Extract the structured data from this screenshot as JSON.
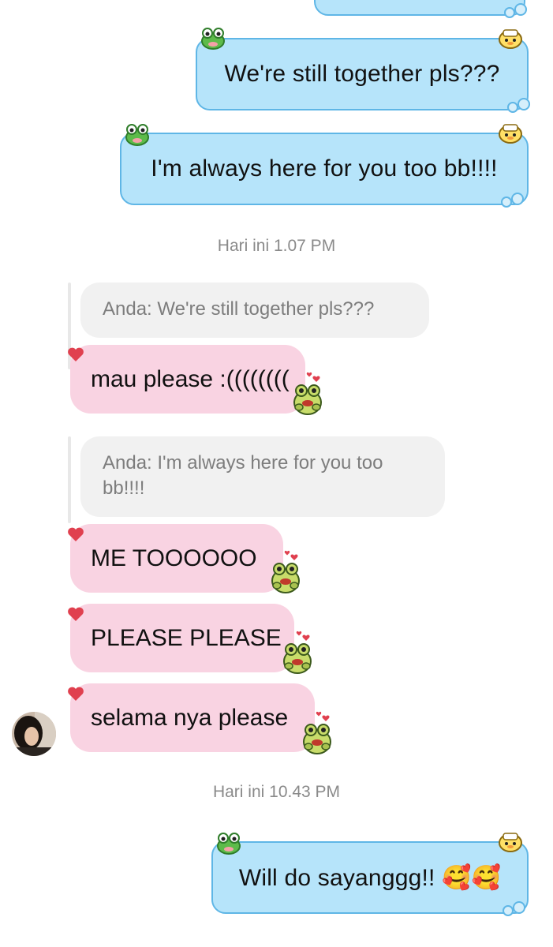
{
  "messages_top": [
    {
      "text": "We're still together pls???"
    },
    {
      "text": "I'm always here for you too bb!!!!"
    }
  ],
  "timestamp_1": "Hari ini 1.07 PM",
  "reply_1": {
    "quote": "Anda: We're still together pls???",
    "message": "mau please :(((((((("
  },
  "reply_2": {
    "quote": "Anda: I'm always here for you too bb!!!!",
    "messages": [
      "ME TOOOOOO",
      "PLEASE PLEASE",
      "selama nya please"
    ]
  },
  "timestamp_2": "Hari ini 10.43 PM",
  "message_bottom": {
    "text": "Will do sayanggg!! 🥰🥰"
  },
  "colors": {
    "outgoing_bubble": "#b6e4fa",
    "outgoing_border": "#5fb6e6",
    "incoming_bubble": "#f9d3e2",
    "quote_bg": "#f1f1f1",
    "heart": "#e0404f"
  },
  "icons": [
    "frog-sticker-icon",
    "duck-sticker-icon",
    "heart-icon",
    "avatar"
  ]
}
